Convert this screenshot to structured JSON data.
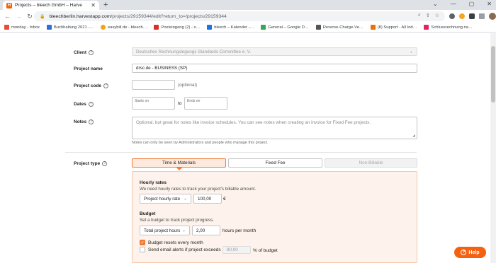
{
  "browser": {
    "tab_title": "Projects – bleech GmbH – Harve",
    "url_host": "bleechberlin.harvestapp.com",
    "url_path": "/projects/29159344/edit?return_to=/projects/29159344",
    "bookmarks": [
      {
        "label": "monday - Inbox",
        "color": "#e44c3c"
      },
      {
        "label": "Buchhaltung 2021 -…",
        "color": "#2f6fdc"
      },
      {
        "label": "easybill.de - bleech…",
        "color": "#f3a319"
      },
      {
        "label": "Posteingang (2) - s…",
        "color": "#d93025"
      },
      {
        "label": "bleech – Kalender -…",
        "color": "#1a73e8"
      },
      {
        "label": "General – Google D…",
        "color": "#34a853"
      },
      {
        "label": "Reverse-Charge-Ve…",
        "color": "#555555"
      },
      {
        "label": "(8) Support - All Ind…",
        "color": "#e8710a"
      },
      {
        "label": "Schlussrechnung na…",
        "color": "#e0245e"
      }
    ]
  },
  "form": {
    "client": {
      "label": "Client",
      "value": "Deutsches Rechnungslegungs Standards Committee e. V."
    },
    "project_name": {
      "label": "Project name",
      "value": "drsc.de - BUSINESS (SP)"
    },
    "project_code": {
      "label": "Project code",
      "value": "",
      "hint": "(optional)"
    },
    "dates": {
      "label": "Dates",
      "start_label": "Starts on",
      "to": "to",
      "end_label": "Ends on"
    },
    "notes": {
      "label": "Notes",
      "placeholder": "Optional, but great for notes like invoice schedules. You can see notes when creating an invoice for Fixed Fee projects.",
      "helper": "Notes can only be seen by Administrators and people who manage this project."
    },
    "project_type": {
      "label": "Project type",
      "options": [
        "Time & Materials",
        "Fixed Fee",
        "Non-Billable"
      ],
      "selected": "Time & Materials"
    },
    "hourly_rates": {
      "title": "Hourly rates",
      "desc": "We need hourly rates to track your project's billable amount.",
      "select": "Project hourly rate",
      "value": "100,00",
      "currency": "€"
    },
    "budget": {
      "title": "Budget",
      "desc": "Set a budget to track project progress.",
      "select": "Total project hours",
      "value": "2,00",
      "unit": "hours per month",
      "resets_label": "Budget resets every month",
      "resets_checked": true,
      "alert_label": "Send email alerts if project exceeds",
      "alert_value": "80,00",
      "alert_suffix": "% of budget",
      "alert_checked": false
    }
  },
  "help_button": "Help"
}
